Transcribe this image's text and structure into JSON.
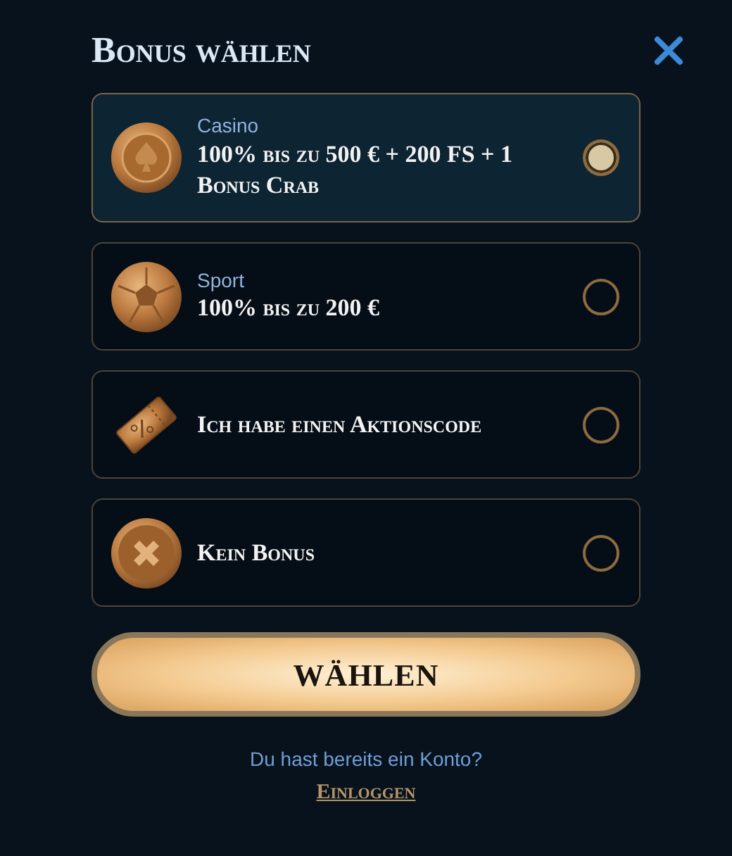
{
  "title": "Bonus wählen",
  "options": [
    {
      "kind": "chip",
      "category": "Casino",
      "label": "100% bis zu 500 € + 200 FS + 1 Bonus Crab",
      "selected": true
    },
    {
      "kind": "ball",
      "category": "Sport",
      "label": "100% bis zu 200 €",
      "selected": false
    },
    {
      "kind": "ticket",
      "label": "Ich habe einen Aktionscode",
      "selected": false
    },
    {
      "kind": "cross",
      "label": "Kein Bonus",
      "selected": false
    }
  ],
  "button": "WÄHLEN",
  "login_prompt": "Du hast bereits ein Konto?",
  "login_link": "Einloggen"
}
